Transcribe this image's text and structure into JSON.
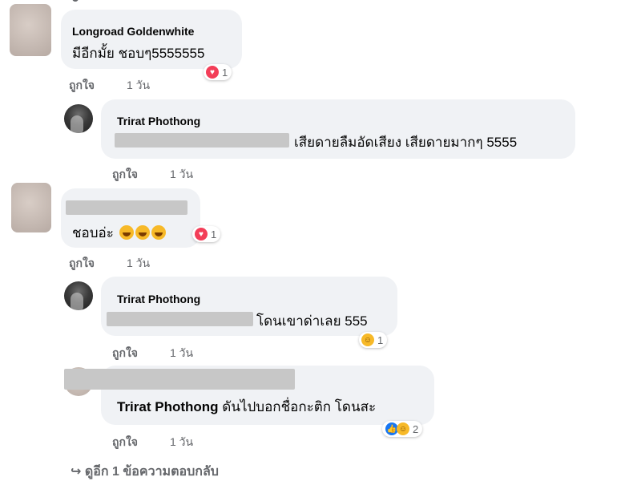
{
  "comments": [
    {
      "name": "Longroad Goldenwhite",
      "text": "มีอีกมั้ย ชอบๆ5555555",
      "like": "ถูกใจ",
      "time": "1 วัน",
      "reaction_count": "1",
      "reaction": "heart-icon"
    },
    {
      "name": "Trirat Phothong",
      "text": "เสียดายลืมอัดเสียง เสียดายมากๆ 5555",
      "like": "ถูกใจ",
      "time": "1 วัน"
    },
    {
      "text": "ชอบอ่ะ",
      "like": "ถูกใจ",
      "time": "1 วัน",
      "reaction_count": "1",
      "reaction": "heart-icon"
    },
    {
      "name": "Trirat Phothong",
      "text": "โดนเขาด่าเลย 555",
      "like": "ถูกใจ",
      "time": "1 วัน",
      "reaction_count": "1",
      "reaction": "haha-icon"
    },
    {
      "tag": "Trirat Phothong",
      "text": "ดันไปบอกชื่อกะติก โดนสะ",
      "like": "ถูกใจ",
      "time": "1 วัน",
      "reaction_count": "2",
      "reaction": "like-haha-icons"
    }
  ],
  "more_replies": "ดูอีก 1 ข้อความตอบกลับ",
  "colors": {
    "bubble": "#f0f2f5",
    "heart": "#f33e58",
    "haha": "#f7b928",
    "like": "#1877f2",
    "meta": "#65676b"
  }
}
